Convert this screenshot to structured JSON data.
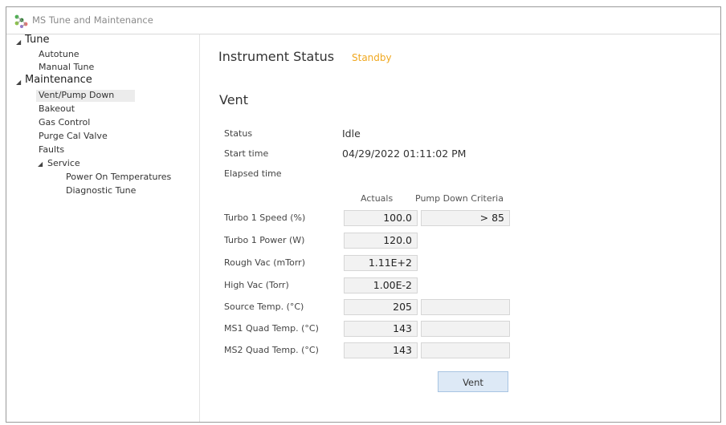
{
  "window": {
    "title": "MS Tune and Maintenance"
  },
  "nav": {
    "tune": "Tune",
    "autotune": "Autotune",
    "manual_tune": "Manual Tune",
    "maintenance": "Maintenance",
    "vent_pump_down": "Vent/Pump Down",
    "bakeout": "Bakeout",
    "gas_control": "Gas Control",
    "purge_cal_valve": "Purge Cal Valve",
    "faults": "Faults",
    "service": "Service",
    "power_on_temperatures": "Power On Temperatures",
    "diagnostic_tune": "Diagnostic Tune",
    "selected": "Vent/Pump Down"
  },
  "instrument": {
    "title": "Instrument Status",
    "status": "Standby",
    "status_color": "#f0a820"
  },
  "vent": {
    "title": "Vent",
    "status_label": "Status",
    "status_value": "Idle",
    "start_label": "Start time",
    "start_value": "04/29/2022 01:11:02 PM",
    "elapsed_label": "Elapsed time",
    "elapsed_value": ""
  },
  "table": {
    "col_actuals": "Actuals",
    "col_criteria": "Pump Down Criteria",
    "rows": [
      {
        "label": "Turbo 1 Speed (%)",
        "actual": "100.0",
        "criteria": "> 85"
      },
      {
        "label": "Turbo 1 Power (W)",
        "actual": "120.0"
      },
      {
        "label": "Rough Vac (mTorr)",
        "actual": "1.11E+2"
      },
      {
        "label": "High Vac (Torr)",
        "actual": "1.00E-2"
      },
      {
        "label": "Source Temp. (°C)",
        "actual": "205",
        "criteria": ""
      },
      {
        "label": "MS1 Quad Temp. (°C)",
        "actual": "143",
        "criteria": ""
      },
      {
        "label": "MS2 Quad Temp. (°C)",
        "actual": "143",
        "criteria": ""
      }
    ]
  },
  "buttons": {
    "vent": "Vent"
  },
  "colors": {
    "button_bg": "#dde9f6",
    "selected_bg": "#ececec"
  }
}
